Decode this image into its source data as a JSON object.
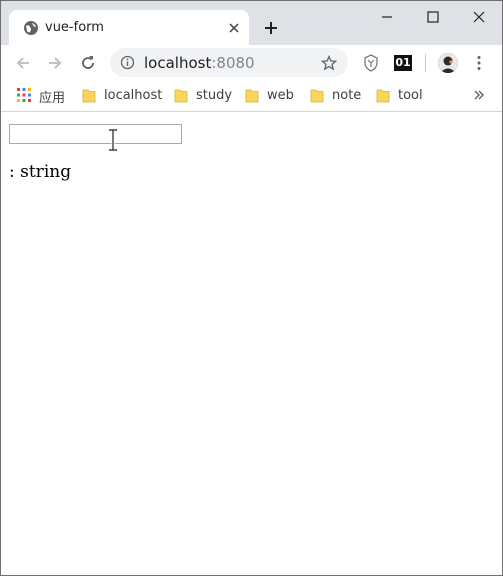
{
  "browser": {
    "tab": {
      "title": "vue-form",
      "favicon": "globe-icon"
    },
    "new_tab_icon": "plus-icon",
    "window_controls": [
      "minimize-icon",
      "maximize-icon",
      "close-icon"
    ],
    "toolbar": {
      "back_icon": "arrow-left-icon",
      "forward_icon": "arrow-right-icon",
      "reload_icon": "reload-icon",
      "url_host": "localhost",
      "url_port": ":8080",
      "info_icon": "info-icon",
      "bookmark_star_icon": "star-icon",
      "extension_1_icon": "shield-extension-icon",
      "extension_2_label": "01",
      "profile_icon": "avatar",
      "menu_icon": "kebab-menu-icon"
    },
    "bookmarks": {
      "apps_label": "应用",
      "items": [
        {
          "label": "localhost"
        },
        {
          "label": "study"
        },
        {
          "label": "web"
        },
        {
          "label": "note"
        },
        {
          "label": "tool"
        }
      ],
      "overflow_icon": "chevron-double-right-icon"
    }
  },
  "page": {
    "input": {
      "value": "",
      "placeholder": ""
    },
    "output_text": ": string"
  },
  "colors": {
    "tabstrip_bg": "#dee1e6",
    "omnibox_bg": "#f1f3f4",
    "folder_yellow": "#f9d65b"
  }
}
